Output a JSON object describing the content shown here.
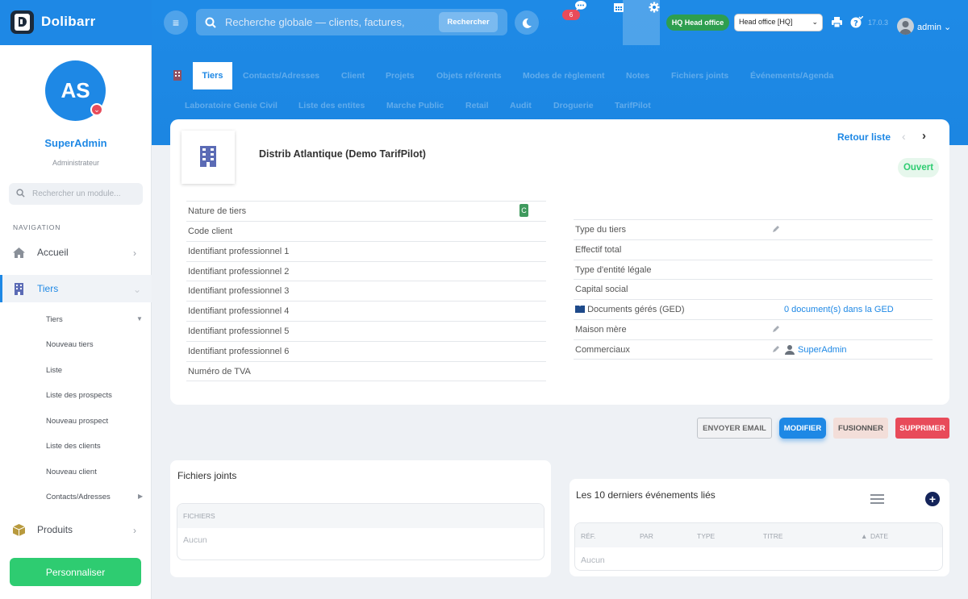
{
  "app": {
    "name": "Dolibarr"
  },
  "user": {
    "initials": "AS",
    "name": "SuperAdmin",
    "role": "Administrateur",
    "menu_label": "admin"
  },
  "sidebar": {
    "search_placeholder": "Rechercher un module...",
    "nav_heading": "NAVIGATION",
    "items": [
      {
        "label": "Accueil",
        "icon": "home-icon"
      },
      {
        "label": "Tiers",
        "icon": "building-icon"
      },
      {
        "label": "Produits",
        "icon": "box-icon"
      }
    ],
    "subitems": [
      "Tiers",
      "Nouveau tiers",
      "Liste",
      "Liste des prospects",
      "Nouveau prospect",
      "Liste des clients",
      "Nouveau client",
      "Contacts/Adresses"
    ],
    "personalize_label": "Personnaliser"
  },
  "header": {
    "search_placeholder": "Recherche globale — clients, factures, produits",
    "search_button": "Rechercher",
    "notification_count": "6",
    "entity_badge": "HQ Head office",
    "entity_select": "Head office [HQ]",
    "version": "17.0.3"
  },
  "tabs": {
    "active": "Tiers",
    "row1": [
      "Contacts/Adresses",
      "Client",
      "Projets",
      "Objets référents",
      "Modes de règlement",
      "Notes",
      "Fichiers joints",
      "Événements/Agenda"
    ],
    "row2": [
      "Laboratoire Genie Civil",
      "Liste des entites",
      "Marche Public",
      "Retail",
      "Audit",
      "Droguerie",
      "TarifPilot"
    ]
  },
  "thirdparty": {
    "name": "Distrib Atlantique (Demo TarifPilot)",
    "back_list": "Retour liste",
    "status": "Ouvert",
    "nature_badge": "C",
    "left_fields": [
      "Nature de tiers",
      "Code client",
      "Identifiant professionnel 1",
      "Identifiant professionnel 2",
      "Identifiant professionnel 3",
      "Identifiant professionnel 4",
      "Identifiant professionnel 5",
      "Identifiant professionnel 6",
      "Numéro de TVA"
    ],
    "right_fields": {
      "type": "Type du tiers",
      "effectif": "Effectif total",
      "entity_type": "Type d'entité légale",
      "capital": "Capital social",
      "ged": "Documents gérés (GED)",
      "ged_value": "0 document(s) dans la GED",
      "parent": "Maison mère",
      "sales": "Commerciaux",
      "sales_value": "SuperAdmin"
    }
  },
  "actions": {
    "email": "ENVOYER EMAIL",
    "modify": "MODIFIER",
    "merge": "FUSIONNER",
    "delete": "SUPPRIMER"
  },
  "files": {
    "title": "Fichiers joints",
    "col": "FICHIERS",
    "empty": "Aucun"
  },
  "events": {
    "title": "Les 10 derniers événements liés",
    "cols": [
      "RÉF.",
      "PAR",
      "TYPE",
      "TITRE",
      "DATE"
    ],
    "empty": "Aucun"
  },
  "colors": {
    "primary": "#1e88e5",
    "success": "#2ecc71",
    "danger": "#e84b5a"
  }
}
